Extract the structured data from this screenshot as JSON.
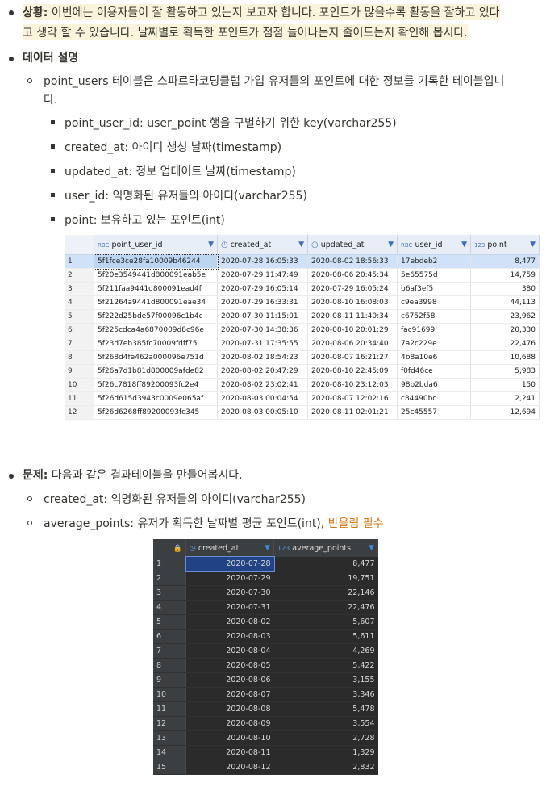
{
  "situation": {
    "label": "상황:",
    "line1": " 이번에는 이용자들이 잘 활동하고 있는지 보고자 합니다. 포인트가 많을수록 활동을 잘하고 있다",
    "line2": "고 생각 할 수 있습니다. 날짜별로 획득한 포인트가 점점 늘어나는지 줄어드는지 확인해 봅시다."
  },
  "data_desc": {
    "label": "데이터 설명",
    "intro1": "point_users 테이블은 스파르타코딩클럽 가입 유저들의 포인트에 대한 정보를 기록한 테이블입니",
    "intro2": "다.",
    "fields": [
      {
        "name": "point_user_id",
        "desc": ": user_point 행을 구별하기 위한 key(varchar255)"
      },
      {
        "name": "created_at",
        "desc": ": 아이디 생성 날짜(timestamp)"
      },
      {
        "name": "updated_at",
        "desc": ": 정보 업데이트 날짜(timestamp)"
      },
      {
        "name": "user_id",
        "desc": ": 익명화된 유저들의 아이디(varchar255)"
      },
      {
        "name": "point",
        "desc": ": 보유하고 있는 포인트(int)"
      }
    ]
  },
  "table1": {
    "headers": [
      {
        "icon": "RBC",
        "label": "point_user_id"
      },
      {
        "icon": "◷",
        "label": "created_at"
      },
      {
        "icon": "◷",
        "label": "updated_at"
      },
      {
        "icon": "RBC",
        "label": "user_id"
      },
      {
        "icon": "123",
        "label": "point"
      }
    ],
    "rows": [
      [
        "1",
        "5f1fce3ce28fa10009b46244",
        "2020-07-28 16:05:33",
        "2020-08-02 18:56:33",
        "17ebdeb2",
        "8,477"
      ],
      [
        "2",
        "5f20e3549441d800091eab5e",
        "2020-07-29 11:47:49",
        "2020-08-06 20:45:34",
        "5e65575d",
        "14,759"
      ],
      [
        "3",
        "5f211faa9441d800091ead4f",
        "2020-07-29 16:05:14",
        "2020-07-29 16:05:24",
        "b6af3ef5",
        "380"
      ],
      [
        "4",
        "5f21264a9441d800091eae34",
        "2020-07-29 16:33:31",
        "2020-08-10 16:08:03",
        "c9ea3998",
        "44,113"
      ],
      [
        "5",
        "5f222d25bde57f00096c1b4c",
        "2020-07-30 11:15:01",
        "2020-08-11 11:40:34",
        "c6752f58",
        "23,962"
      ],
      [
        "6",
        "5f225cdca4a6870009d8c96e",
        "2020-07-30 14:38:36",
        "2020-08-10 20:01:29",
        "fac91699",
        "20,330"
      ],
      [
        "7",
        "5f23d7eb385fc70009fdff75",
        "2020-07-31 17:35:55",
        "2020-08-06 20:34:40",
        "7a2c229e",
        "22,476"
      ],
      [
        "8",
        "5f268d4fe462a000096e751d",
        "2020-08-02 18:54:23",
        "2020-08-07 16:21:27",
        "4b8a10e6",
        "10,688"
      ],
      [
        "9",
        "5f26a7d1b81d800009afde82",
        "2020-08-02 20:47:29",
        "2020-08-10 22:45:09",
        "f0fd46ce",
        "5,983"
      ],
      [
        "10",
        "5f26c7818ff89200093fc2e4",
        "2020-08-02 23:02:41",
        "2020-08-10 23:12:03",
        "98b2bda6",
        "150"
      ],
      [
        "11",
        "5f26d615d3943c0009e065af",
        "2020-08-03 00:04:54",
        "2020-08-07 12:02:16",
        "c84490bc",
        "2,241"
      ],
      [
        "12",
        "5f26d6268ff89200093fc345",
        "2020-08-03 00:05:10",
        "2020-08-11 02:01:21",
        "25c45557",
        "12,694"
      ]
    ]
  },
  "problem": {
    "label": "문제:",
    "text": " 다음과 같은 결과테이블을 만들어봅시다.",
    "items": [
      {
        "text": "created_at: 익명화된 유저들의 아이디(varchar255)",
        "note": ""
      },
      {
        "text": "average_points: 유저가 획득한 날짜별 평균 포인트(int), ",
        "note": "반올림 필수"
      }
    ]
  },
  "table2": {
    "headers": [
      {
        "icon": "◷",
        "label": "created_at"
      },
      {
        "icon": "123",
        "label": "average_points"
      }
    ],
    "rows": [
      [
        "1",
        "2020-07-28",
        "8,477"
      ],
      [
        "2",
        "2020-07-29",
        "19,751"
      ],
      [
        "3",
        "2020-07-30",
        "22,146"
      ],
      [
        "4",
        "2020-07-31",
        "22,476"
      ],
      [
        "5",
        "2020-08-02",
        "5,607"
      ],
      [
        "6",
        "2020-08-03",
        "5,611"
      ],
      [
        "7",
        "2020-08-04",
        "4,269"
      ],
      [
        "8",
        "2020-08-05",
        "5,422"
      ],
      [
        "9",
        "2020-08-06",
        "3,155"
      ],
      [
        "10",
        "2020-08-07",
        "3,346"
      ],
      [
        "11",
        "2020-08-08",
        "5,478"
      ],
      [
        "12",
        "2020-08-09",
        "3,554"
      ],
      [
        "13",
        "2020-08-10",
        "2,728"
      ],
      [
        "14",
        "2020-08-11",
        "1,329"
      ],
      [
        "15",
        "2020-08-12",
        "2,832"
      ]
    ]
  }
}
